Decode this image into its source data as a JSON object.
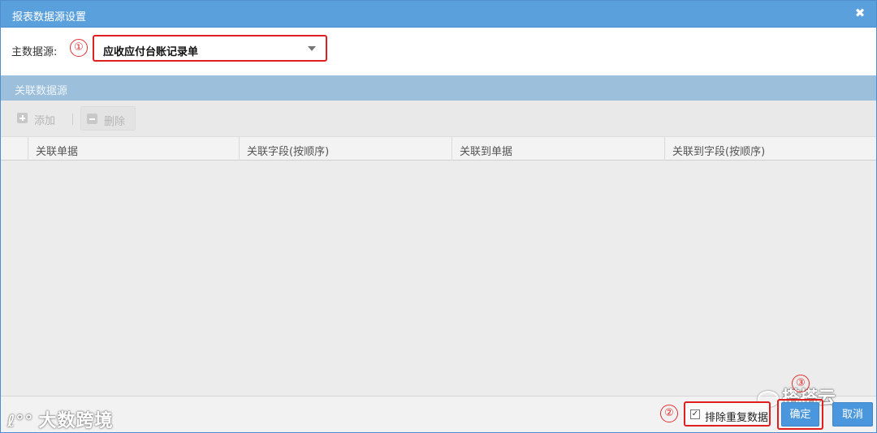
{
  "dialog": {
    "title": "报表数据源设置",
    "close_glyph": "✖"
  },
  "main_source": {
    "label": "主数据源:",
    "selected": "应收应付台账记录单",
    "marker": "①"
  },
  "related": {
    "section_title": "关联数据源",
    "toolbar": {
      "add_label": "添加",
      "delete_label": "删除"
    },
    "columns": [
      "关联单据",
      "关联字段(按顺序)",
      "关联到单据",
      "关联到字段(按顺序)"
    ]
  },
  "footer": {
    "exclude_duplicates_label": "排除重复数据",
    "exclude_duplicates_checked": true,
    "marker2": "②",
    "marker3": "③",
    "ok_label": "确定",
    "cancel_label": "取消",
    "watermark_left": "大数跨境",
    "watermark_right": "搭搭云"
  },
  "colors": {
    "titlebar": "#5aa0dd",
    "section_header": "#9cbfdb",
    "annotation_red": "#e02020",
    "primary_button": "#4a97dd"
  }
}
